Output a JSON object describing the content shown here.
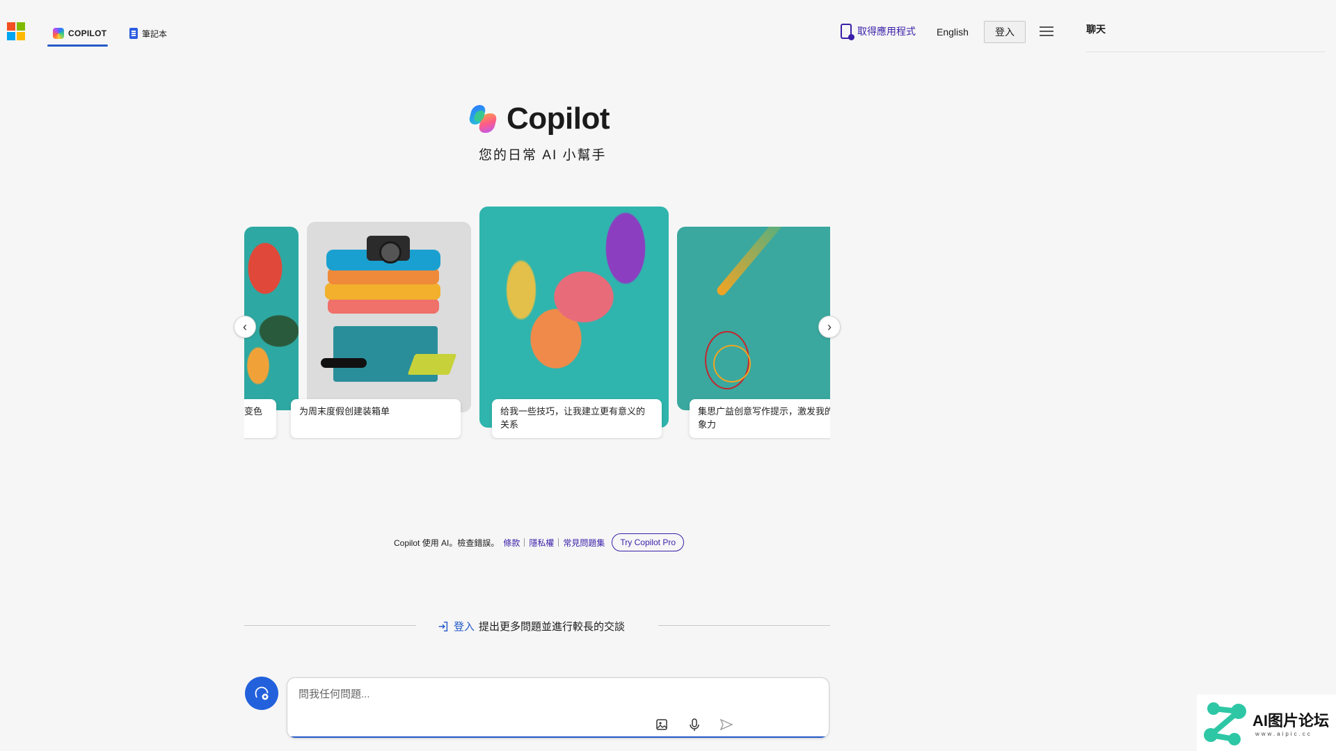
{
  "nav": {
    "tab_copilot": "COPILOT",
    "tab_notebook": "筆記本",
    "get_app": "取得應用程式",
    "language": "English",
    "sign_in": "登入",
    "active_tab": "COPILOT"
  },
  "side_panel": {
    "title": "聊天"
  },
  "hero": {
    "title": "Copilot",
    "subtitle": "您的日常 AI 小幫手"
  },
  "carousel": {
    "cards": [
      {
        "caption": "变色"
      },
      {
        "caption": "为周末度假创建装箱单"
      },
      {
        "caption": "给我一些技巧，让我建立更有意义的关系"
      },
      {
        "caption": "集思广益创意写作提示，激发我的想象力"
      }
    ]
  },
  "notes": {
    "disclaimer": "Copilot 使用 AI。檢查錯誤。",
    "terms": "條款",
    "privacy": "隱私權",
    "faq": "常見問題集",
    "try_pro": "Try Copilot Pro"
  },
  "signin_prompt": {
    "link": "登入",
    "text": "提出更多問題並進行較長的交談"
  },
  "composer": {
    "placeholder": "問我任何問題..."
  },
  "watermark": {
    "text": "AI图片论坛",
    "url": "www.aipic.cc"
  },
  "colors": {
    "accent": "#2459c9",
    "link": "#3a1fa8",
    "background": "#f6f6f6"
  }
}
